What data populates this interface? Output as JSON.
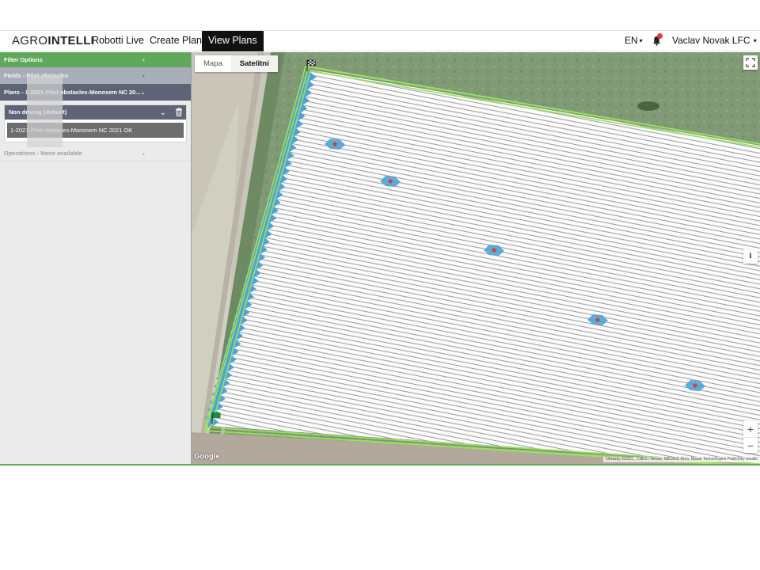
{
  "brand": {
    "light": "AGRO",
    "bold": "INTELLI"
  },
  "nav": {
    "links": [
      {
        "label": "Robotti Live"
      },
      {
        "label": "Create Plan"
      },
      {
        "label": "View Plans",
        "active": true
      }
    ],
    "language": "EN",
    "notifications_icon": "bell-icon",
    "user": "Vaclav Novak LFC"
  },
  "sidebar": {
    "filter_label": "Filter Options",
    "fields_label": "Fields - Pilot obstacles",
    "plans_label": "Plans - 1-2021-Pilot obstacles-Monosem NC 20...",
    "non_driving_label": "Non driving (default)",
    "plan_item": "1-2021-Pilot obstacles-Monosem NC 2021 OK",
    "operations_label": "Operations - None available"
  },
  "map": {
    "map_types": [
      "Mapa",
      "Satelitní"
    ],
    "selected_map_type": "Satelitní",
    "zoom_in": "+",
    "zoom_out": "−",
    "info": "i",
    "google": "Google",
    "attribution": "Obrázky ©2021 , CNES / Airbus, GEODIS Brno, Maxar Technologies    Podmínky použití",
    "obstacles_count": 6
  },
  "colors": {
    "accent_green": "#5fa85c",
    "panel_dark": "#5e6476",
    "panel_light": "#a7adb9",
    "path_blue": "#4ea3d6",
    "field_boundary": "#9be060",
    "obstacle_red": "#d8412f"
  }
}
